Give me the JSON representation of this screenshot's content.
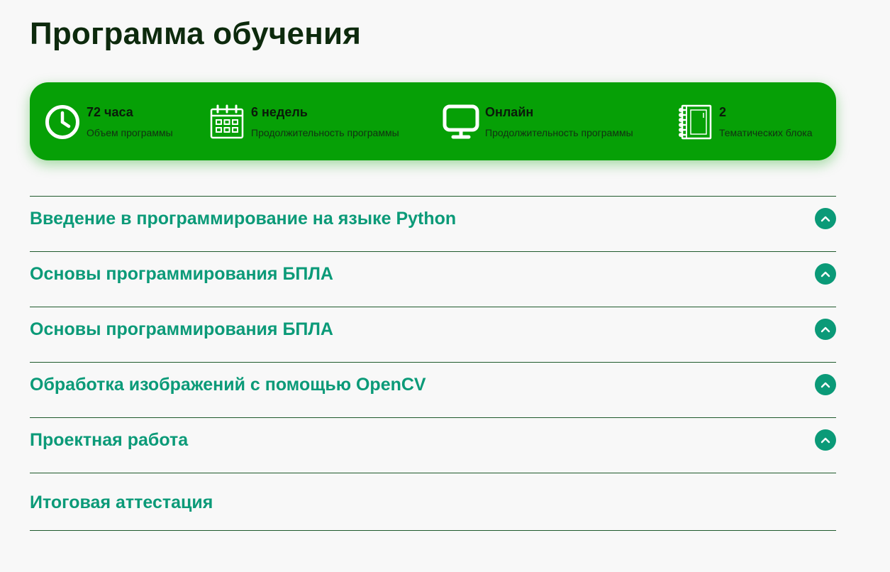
{
  "page": {
    "title": "Программа обучения"
  },
  "stats": [
    {
      "icon": "clock-icon",
      "value": "72 часа",
      "caption": "Объем программы"
    },
    {
      "icon": "calendar-icon",
      "value": "6 недель",
      "caption": "Продолжительность программы"
    },
    {
      "icon": "monitor-icon",
      "value": "Онлайн",
      "caption": "Продолжительность программы"
    },
    {
      "icon": "notebook-icon",
      "value": "2",
      "caption": "Тематических блока"
    }
  ],
  "modules": [
    {
      "title": "Введение в программирование на языке Python",
      "toggle_icon": "chevron-up-icon"
    },
    {
      "title": "Основы программирования БПЛА",
      "toggle_icon": "chevron-up-icon"
    },
    {
      "title": "Основы программирования БПЛА",
      "toggle_icon": "chevron-up-icon"
    },
    {
      "title": "Обработка изображений с помощью OpenCV",
      "toggle_icon": "chevron-up-icon"
    },
    {
      "title": "Проектная работа",
      "toggle_icon": "chevron-up-icon"
    },
    {
      "title": "Итоговая аттестация"
    }
  ],
  "colors": {
    "background": "#f8f8f8",
    "stats_bar": "#06a006",
    "accent": "#0b9a78",
    "title": "#0d2a0d",
    "divider": "#1f5a2c"
  }
}
